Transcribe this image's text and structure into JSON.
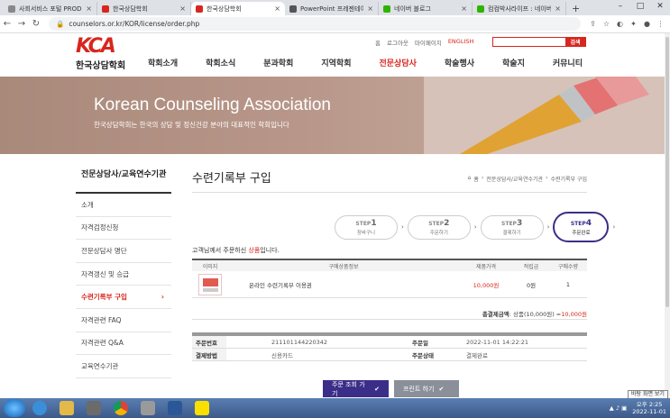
{
  "browser": {
    "tabs": [
      {
        "label": "사회서비스 포털 PROD",
        "color": "#888888"
      },
      {
        "label": "한국상담학회",
        "color": "#d7261e"
      },
      {
        "label": "한국상담학회",
        "color": "#d7261e",
        "active": true
      },
      {
        "label": "PowerPoint 프레젠테이션",
        "color": "#555555"
      },
      {
        "label": "네이버 블로그",
        "color": "#2db400"
      },
      {
        "label": "컴컴박사라이프 : 네이버",
        "color": "#2db400"
      }
    ],
    "url": "counselors.or.kr/KOR/license/order.php"
  },
  "site": {
    "logo_mark": "KCA",
    "logo_name": "한국상담학회",
    "util": [
      "홈",
      "로그아웃",
      "마이페이지",
      "ENGLISH"
    ],
    "search_button": "검색",
    "gnb": [
      "학회소개",
      "학회소식",
      "분과학회",
      "지역학회",
      "전문상담사",
      "학술행사",
      "학술지",
      "커뮤니티"
    ],
    "hero_title": "Korean Counseling Association",
    "hero_sub": "한국상담학회는 한국의 상담 및 정신건강 분야의 대표적인 학회입니다"
  },
  "lnb": {
    "title": "전문상담사/교육연수기관",
    "items": [
      "소개",
      "자격검정신청",
      "전문상담사 명단",
      "자격갱신 및 승급",
      "수련기록부 구입",
      "자격관련 FAQ",
      "자격관련 Q&A",
      "교육연수기관"
    ]
  },
  "content": {
    "page_title": "수련기록부 구입",
    "breadcrumb": [
      "홈",
      "전문상담사/교육연수기관",
      "수련기록부 구입"
    ],
    "steps": [
      {
        "num": "1",
        "label": "장바구니"
      },
      {
        "num": "2",
        "label": "주문하기"
      },
      {
        "num": "3",
        "label": "결제하기"
      },
      {
        "num": "4",
        "label": "주문완료"
      }
    ],
    "step_prefix": "STEP",
    "notice_pre": "고객님께서 주문하신",
    "notice_red": " 상품",
    "notice_post": "입니다.",
    "table_headers": [
      "이미지",
      "구매상품정보",
      "제품가격",
      "적립금",
      "구매수량"
    ],
    "row": {
      "name": "온라인 수련기록부 이용권",
      "price": "10,000원",
      "points": "0원",
      "qty": "1"
    },
    "total_label": "총결제금액",
    "total_detail": ": 상품(10,000원) = ",
    "total_value": "10,000원",
    "info": [
      {
        "k1": "주문번호",
        "v1": "211101144220342",
        "k2": "주문일",
        "v2": "2022-11-01 14:22:21"
      },
      {
        "k1": "결제방법",
        "v1": "신용카드",
        "k2": "주문상태",
        "v2": "결제완료"
      }
    ],
    "btn_order": "주문 조회 가기",
    "btn_print": "프린트 하기"
  },
  "taskbar": {
    "time": "오후 2:25",
    "date": "2022-11-01",
    "tooltip": "바탕 화면 보기"
  }
}
